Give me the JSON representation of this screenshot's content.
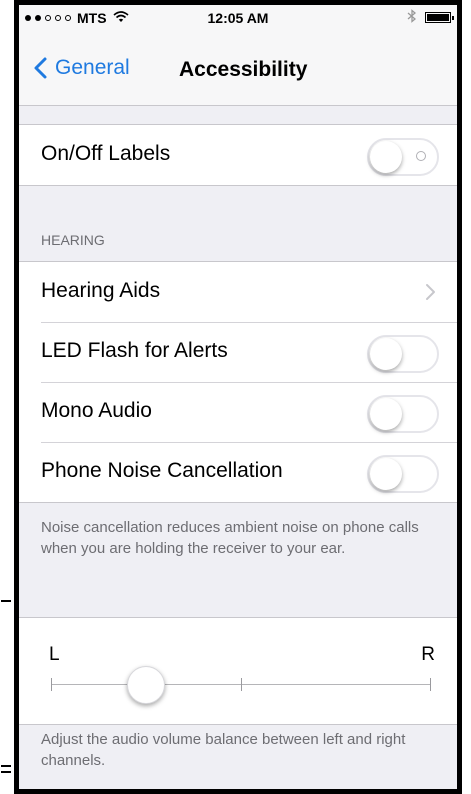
{
  "status_bar": {
    "carrier": "MTS",
    "time": "12:05 AM",
    "signal": {
      "filled": 2,
      "total": 5
    },
    "wifi_icon": "wifi-icon",
    "bluetooth_icon": "bluetooth-icon",
    "battery_icon": "battery-icon"
  },
  "nav": {
    "back_label": "General",
    "title": "Accessibility",
    "accent": "#1f7ae0"
  },
  "sections": {
    "top": {
      "rows": [
        {
          "label": "On/Off Labels",
          "control": "switch",
          "on": false
        }
      ]
    },
    "hearing": {
      "header": "HEARING",
      "rows": [
        {
          "label": "Hearing Aids",
          "control": "chevron"
        },
        {
          "label": "LED Flash for Alerts",
          "control": "switch",
          "on": false
        },
        {
          "label": "Mono Audio",
          "control": "switch",
          "on": false
        },
        {
          "label": "Phone Noise Cancellation",
          "control": "switch",
          "on": false
        }
      ],
      "footer": "Noise cancellation reduces ambient noise on phone calls when you are holding the receiver to your ear."
    },
    "balance": {
      "left_label": "L",
      "right_label": "R",
      "value": -0.5,
      "footer": "Adjust the audio volume balance between left and right channels."
    }
  }
}
